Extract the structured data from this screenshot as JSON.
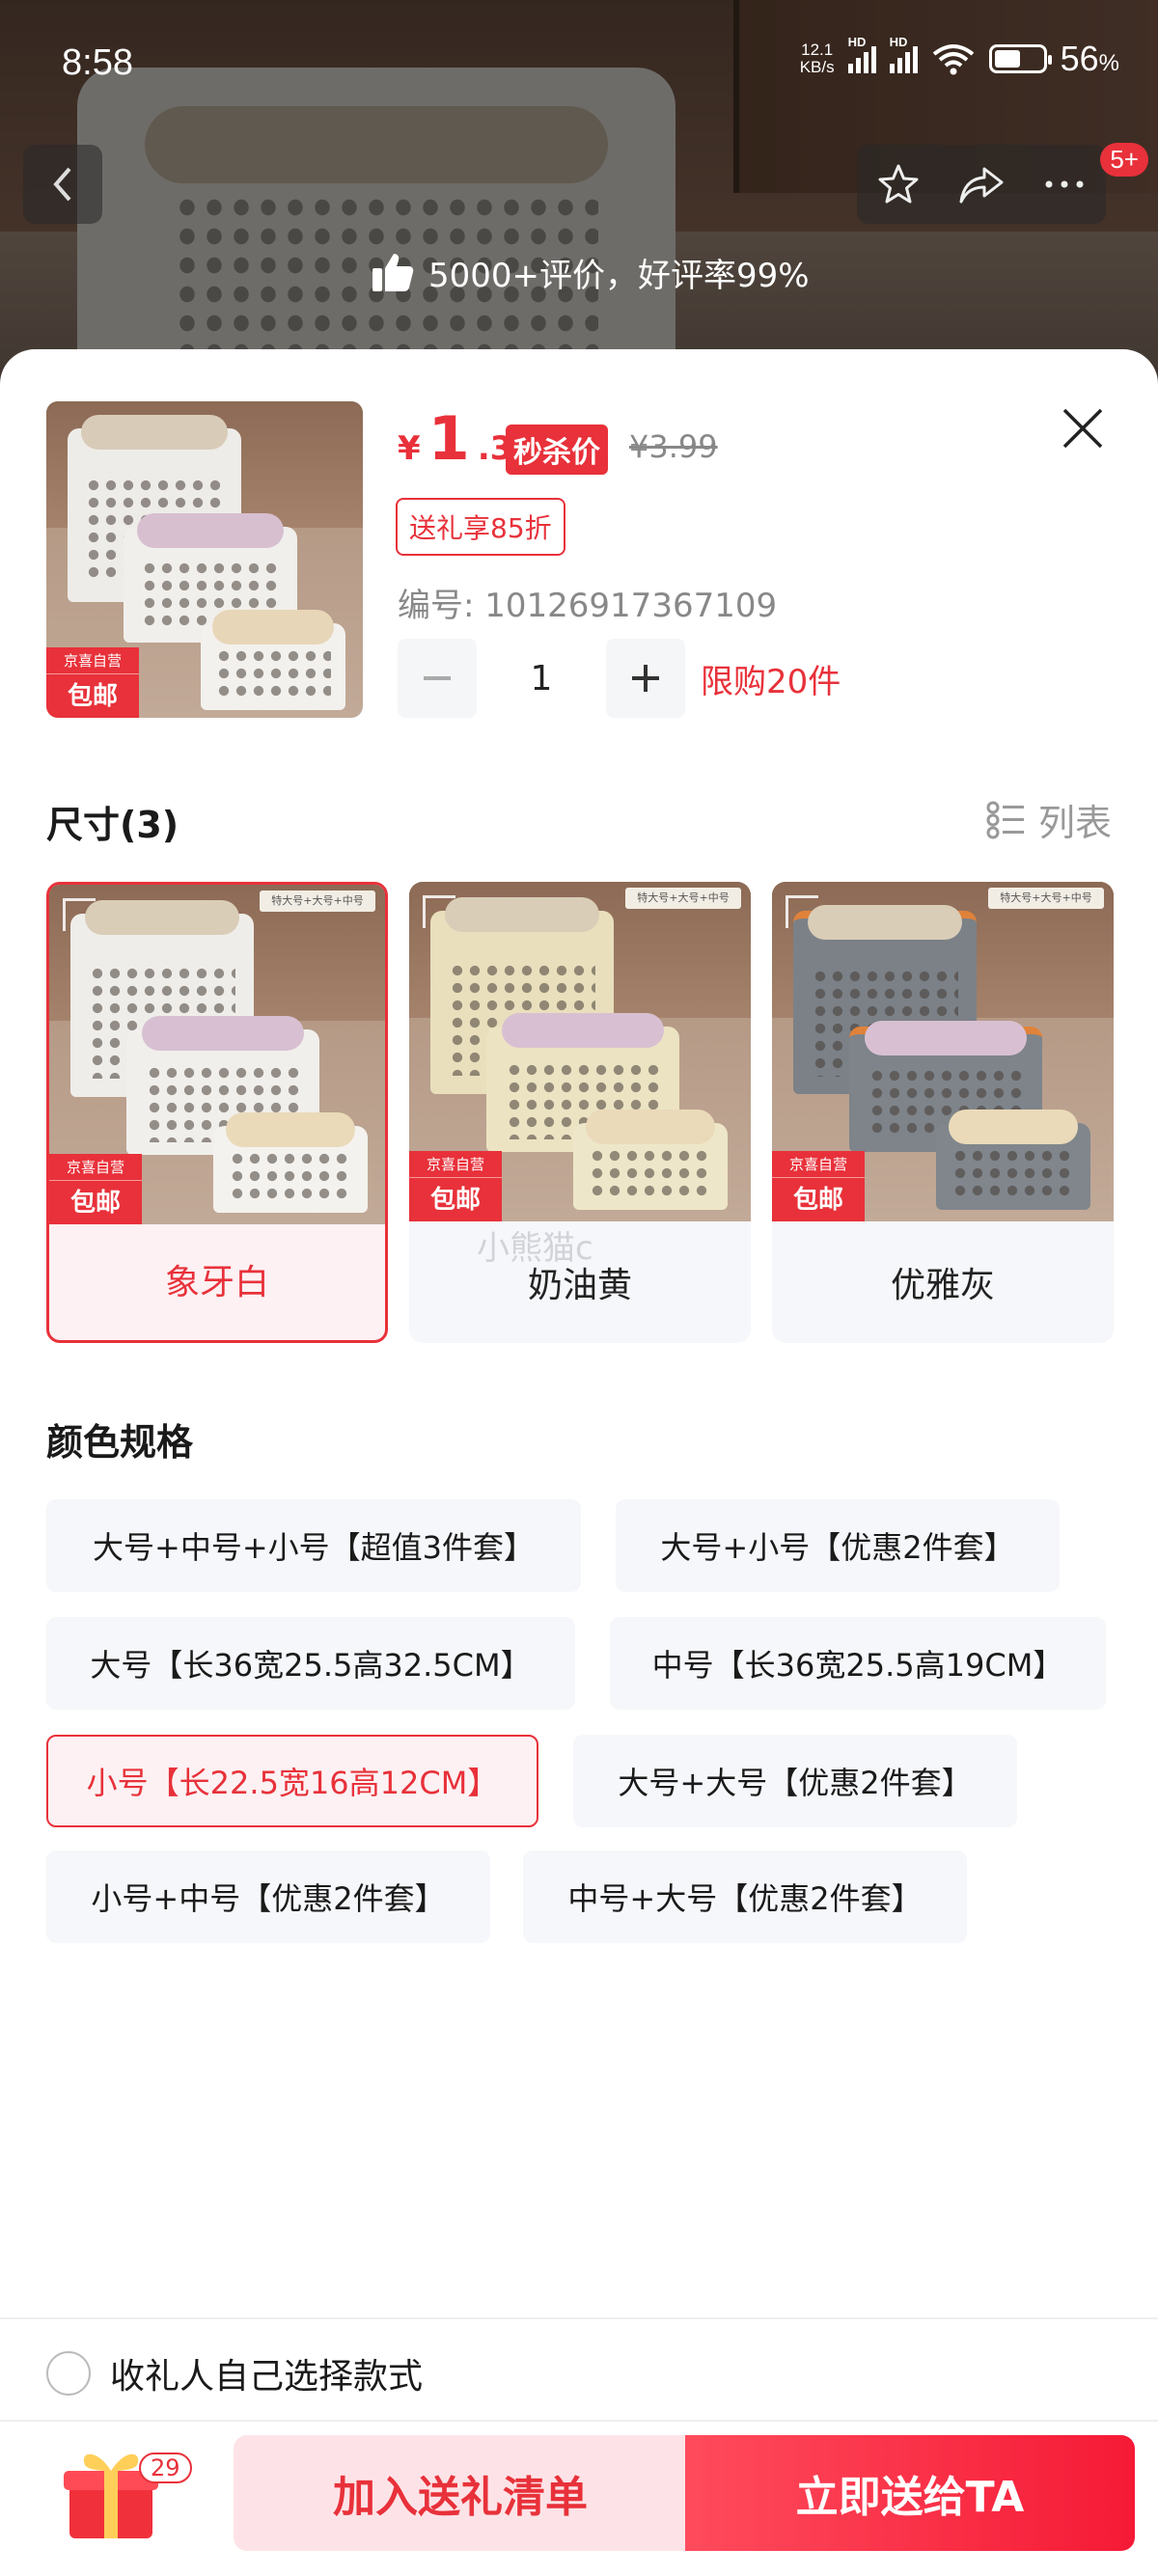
{
  "status_bar": {
    "time": "8:58",
    "net_speed_value": "12.1",
    "net_speed_unit": "KB/s",
    "hd_1": "HD",
    "hd_2": "HD",
    "wifi_sub": "6",
    "battery_pct": "56",
    "battery_unit": "%"
  },
  "top": {
    "more_badge": "5+",
    "review_text": "5000+评价，好评率99%"
  },
  "product": {
    "currency": "¥",
    "price_int": "1",
    "price_dec": ".39",
    "seckill_label": "秒杀价",
    "original_price": "¥3.99",
    "coupon": "送礼享85折",
    "code": "编号: 10126917367109",
    "quantity": "1",
    "limit": "限购20件",
    "thumb_tag_top": "京喜自营",
    "thumb_tag_bottom": "包邮"
  },
  "size_section": {
    "title": "尺寸(3)",
    "list_toggle": "列表",
    "options": [
      {
        "label": "象牙白",
        "tag_top": "京喜自营",
        "tag_bottom": "包邮",
        "selected": true
      },
      {
        "label": "奶油黄",
        "tag_top": "京喜自营",
        "tag_bottom": "包邮",
        "selected": false
      },
      {
        "label": "优雅灰",
        "tag_top": "京喜自营",
        "tag_bottom": "包邮",
        "selected": false
      }
    ],
    "watermark": "小熊猫c"
  },
  "spec_section": {
    "title": "颜色规格",
    "options": [
      {
        "label": "大号+中号+小号【超值3件套】",
        "selected": false
      },
      {
        "label": "大号+小号【优惠2件套】",
        "selected": false
      },
      {
        "label": "大号【长36宽25.5高32.5CM】",
        "selected": false
      },
      {
        "label": "中号【长36宽25.5高19CM】",
        "selected": false
      },
      {
        "label": "小号【长22.5宽16高12CM】",
        "selected": true
      },
      {
        "label": "大号+大号【优惠2件套】",
        "selected": false
      },
      {
        "label": "小号+中号【优惠2件套】",
        "selected": false
      },
      {
        "label": "中号+大号【优惠2件套】",
        "selected": false
      }
    ]
  },
  "bottom": {
    "recipient_choose": "收礼人自己选择款式",
    "gift_count": "29",
    "add_to_gift_list": "加入送礼清单",
    "send_now": "立即送给TA"
  },
  "colors": {
    "accent": "#e8313a",
    "accent_light": "#fdf1f3",
    "chip_bg": "#f6f7fa"
  }
}
